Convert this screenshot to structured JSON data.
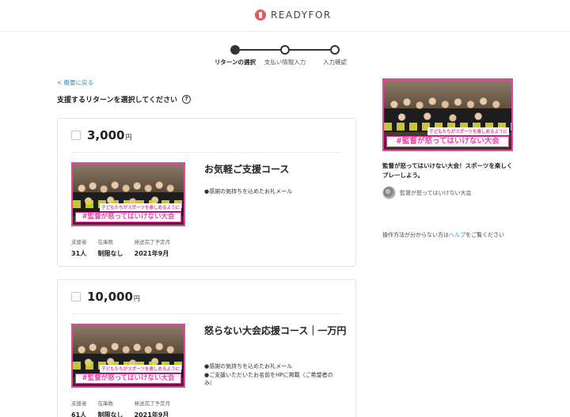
{
  "header": {
    "logo_text": "READYFOR",
    "logo_icon": "readyfor-logo-icon"
  },
  "stepper": {
    "steps": [
      {
        "label": "リターンの選択",
        "active": true
      },
      {
        "label": "支払い情報入力",
        "active": false
      },
      {
        "label": "入力確認",
        "active": false
      }
    ]
  },
  "nav": {
    "back_label": "< 概要に戻る"
  },
  "section": {
    "title": "支援するリターンを選択してください",
    "help_icon": "question-circle-icon",
    "help_glyph": "?"
  },
  "returns": [
    {
      "price": "3,000",
      "currency": "円",
      "title": "お気軽ご支援コース",
      "features": [
        "●感謝の気持ちを込めたお礼メール"
      ],
      "image_caption_small": "子どもたちがスポーツを楽しめるように",
      "image_caption_large": "#監督が怒ってはいけない大会",
      "meta": [
        {
          "label": "支援者",
          "value": "31人"
        },
        {
          "label": "在庫数",
          "value": "制限なし"
        },
        {
          "label": "発送完了予定月",
          "value": "2021年9月"
        }
      ]
    },
    {
      "price": "10,000",
      "currency": "円",
      "title": "怒らない大会応援コース｜一万円",
      "features": [
        "●感謝の気持ちを込めたお礼メール",
        "●ご支援いただいたお名前をHPに掲載（ご希望者のみ）"
      ],
      "image_caption_small": "子どもたちがスポーツを楽しめるように",
      "image_caption_large": "#監督が怒ってはいけない大会",
      "meta": [
        {
          "label": "支援者",
          "value": "61人"
        },
        {
          "label": "在庫数",
          "value": "制限なし"
        },
        {
          "label": "発送完了予定月",
          "value": "2021年9月"
        }
      ]
    }
  ],
  "sidebar": {
    "image_caption_small": "子どもたちがスポーツを楽しめるように",
    "image_caption_large": "#監督が怒ってはいけない大会",
    "project_title": "監督が怒ってはいけない大会！スポーツを楽しくプレーしよう。",
    "owner_name": "監督が怒ってはいけない大会",
    "help_prefix": "操作方法が分からない方は",
    "help_link": "ヘルプ",
    "help_suffix": "をご覧ください"
  },
  "colors": {
    "accent_pink": "#e844a6",
    "link_blue": "#2a8fd0",
    "logo_red": "#f0555f"
  }
}
